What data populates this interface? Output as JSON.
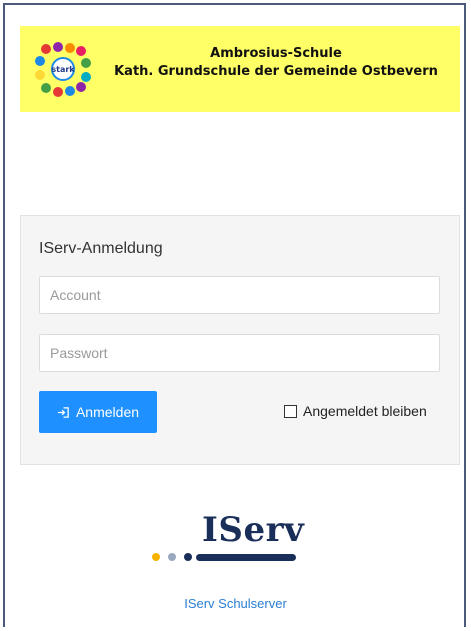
{
  "banner": {
    "school_name": "Ambrosius-Schule",
    "school_subtitle": "Kath. Grundschule der Gemeinde Ostbevern",
    "logo_text": "stark",
    "background_color": "#ffff66"
  },
  "login": {
    "title": "IServ-Anmeldung",
    "account_placeholder": "Account",
    "account_value": "",
    "password_placeholder": "Passwort",
    "password_value": "",
    "submit_label": "Anmelden",
    "submit_icon": "login-icon",
    "remember_label": "Angemeldet bleiben",
    "remember_checked": false,
    "accent_color": "#1e90ff"
  },
  "footer": {
    "brand": "IServ",
    "link_label": "IServ Schulserver"
  }
}
